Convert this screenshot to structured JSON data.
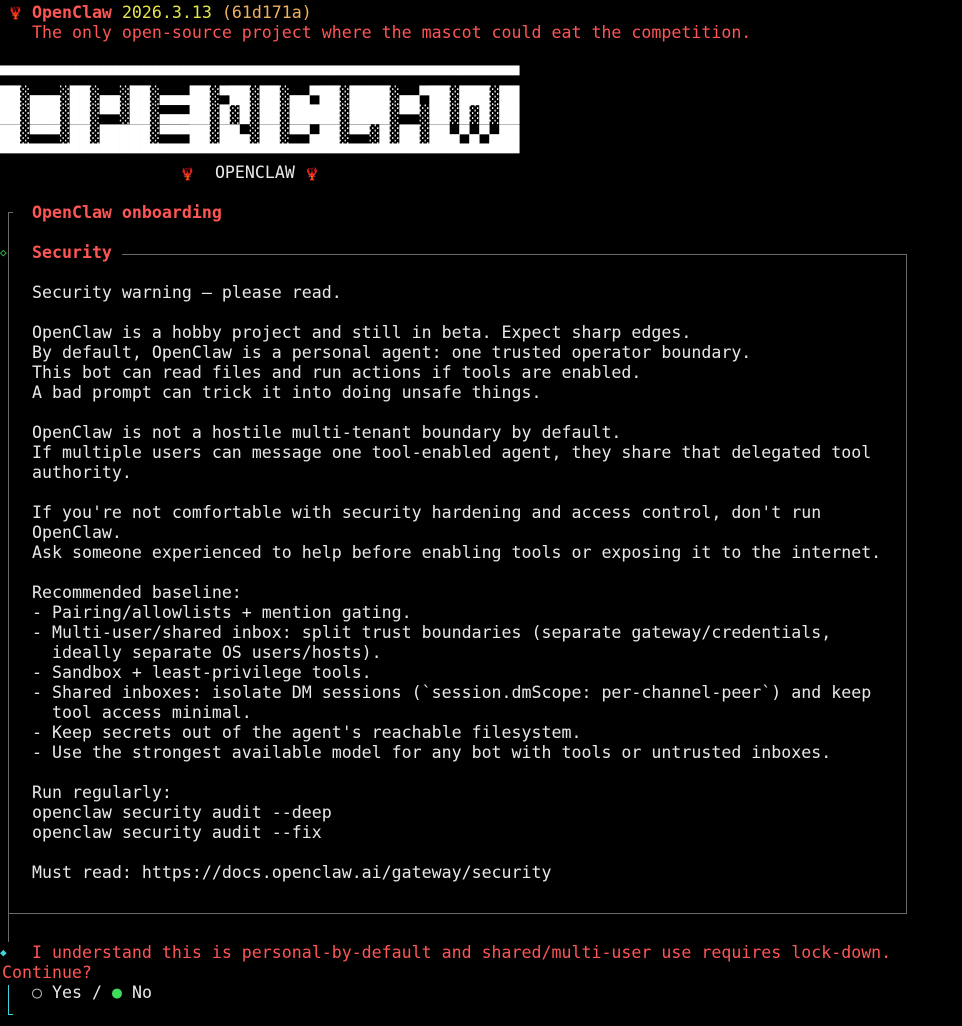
{
  "header": {
    "app_name": "OpenClaw",
    "version": "2026.3.13",
    "commit": "(61d171a)",
    "tagline": "The only open-source project where the mascot could eat the competition."
  },
  "banner": {
    "art_lines": [
      "▀▀▀▀▀▀▀▀▀▀▀▀▀▀▀▀▀▀▀▀▀▀▀▀▀▀▀▀▀▀▀▀▀▀▀▀▀▀▀▀▀▀▀▀▀▀▀▀▀▀▀▀",
      "██░▄▄▄░██░▄▄░██░▄▄▄██░▀██░██░▄▄▀██░████░▄▄▀██░███░██",
      "██░███░██░▀▀░██░▄▄▄██░█░█░██░█████░████░▀▀░██░█░█░██",
      "██░▀▀▀░██░█████░▀▀▀██░██▄░██░▀▀▄██░▀▀░█░██░██▄▀▄▀▄██",
      "▀▀▀▀▀▀▀▀▀▀▀▀▀▀▀▀▀▀▀▀▀▀▀▀▀▀▀▀▀▀▀▀▀▀▀▀▀▀▀▀▀▀▀▀▀▀▀▀▀▀▀▀"
    ],
    "caption": "OPENCLAW",
    "mascot_icon": "🦞"
  },
  "onboarding": {
    "title": "OpenClaw onboarding",
    "section_title": "Security",
    "lines": [
      "Security warning — please read.",
      "",
      "OpenClaw is a hobby project and still in beta. Expect sharp edges.",
      "By default, OpenClaw is a personal agent: one trusted operator boundary.",
      "This bot can read files and run actions if tools are enabled.",
      "A bad prompt can trick it into doing unsafe things.",
      "",
      "OpenClaw is not a hostile multi-tenant boundary by default.",
      "If multiple users can message one tool-enabled agent, they share that delegated tool",
      "authority.",
      "",
      "If you're not comfortable with security hardening and access control, don't run",
      "OpenClaw.",
      "Ask someone experienced to help before enabling tools or exposing it to the internet.",
      "",
      "Recommended baseline:",
      "- Pairing/allowlists + mention gating.",
      "- Multi-user/shared inbox: split trust boundaries (separate gateway/credentials,",
      "  ideally separate OS users/hosts).",
      "- Sandbox + least-privilege tools.",
      "- Shared inboxes: isolate DM sessions (`session.dmScope: per-channel-peer`) and keep",
      "  tool access minimal.",
      "- Keep secrets out of the agent's reachable filesystem.",
      "- Use the strongest available model for any bot with tools or untrusted inboxes.",
      "",
      "Run regularly:",
      "openclaw security audit --deep",
      "openclaw security audit --fix",
      "",
      "Must read: https://docs.openclaw.ai/gateway/security"
    ]
  },
  "prompt": {
    "question": "I understand this is personal-by-default and shared/multi-user use requires lock-down.",
    "question_cont": "Continue?",
    "options": [
      {
        "label": "Yes",
        "selected": false
      },
      {
        "label": "No",
        "selected": true
      }
    ],
    "separator": "/"
  },
  "colors": {
    "accent": "#ff5555",
    "version": "#e5e54a",
    "active": "#3fdc5a",
    "cursor": "#3fd6e0"
  }
}
